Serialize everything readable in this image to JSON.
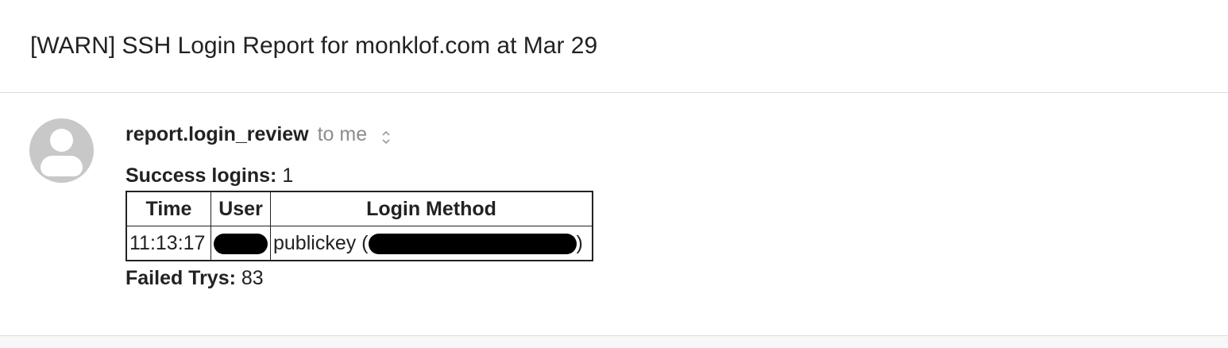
{
  "email": {
    "subject": "[WARN] SSH Login Report for monklof.com at Mar 29",
    "sender": "report.login_review",
    "recipient": "to me",
    "success_label": "Success logins:",
    "success_count": "1",
    "table": {
      "headers": [
        "Time",
        "User",
        "Login Method"
      ],
      "rows": [
        {
          "time": "11:13:17",
          "user": "[redacted]",
          "method": "publickey (",
          "ip": "[redacted]",
          "close": ")"
        }
      ]
    },
    "failed_label": "Failed Trys:",
    "failed_count": "83"
  },
  "colors": {
    "avatar": "#c8c8c8",
    "link": "#3b73c6",
    "muted": "#8c8c8c"
  },
  "icons": {
    "expand": "expand-collapse-icon",
    "avatar": "default-avatar-icon"
  }
}
